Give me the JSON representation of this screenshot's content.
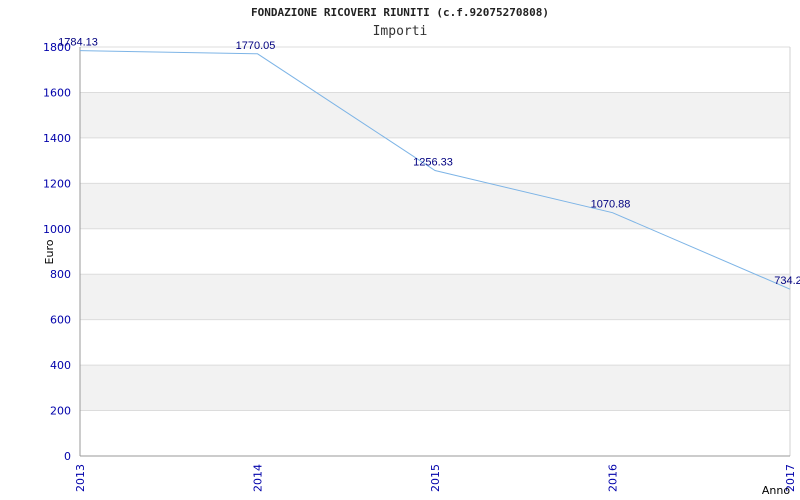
{
  "header": {
    "title": "FONDAZIONE RICOVERI RIUNITI (c.f.92075270808)",
    "subtitle": "Importi"
  },
  "chart_data": {
    "type": "line",
    "title": "FONDAZIONE RICOVERI RIUNITI (c.f.92075270808)",
    "subtitle": "Importi",
    "xlabel": "Anno",
    "ylabel": "Euro",
    "categories": [
      "2013",
      "2014",
      "2015",
      "2016",
      "2017"
    ],
    "series": [
      {
        "values": [
          1784.13,
          1770.05,
          1256.33,
          1070.88,
          734.2
        ]
      }
    ],
    "data_labels": [
      "1784.13",
      "1770.05",
      "1256.33",
      "1070.88",
      "734.2"
    ],
    "y_ticks": [
      0,
      200,
      400,
      600,
      800,
      1000,
      1200,
      1400,
      1600,
      1800
    ],
    "ylim": [
      0,
      1800
    ],
    "grid": true,
    "legend": "none",
    "colors": {
      "line": "#7db4e6",
      "band_alt": "#f2f2f2",
      "grid": "#dcdcdc",
      "axis": "#999999",
      "tick_label": "#0000aa",
      "data_label": "#000080"
    }
  }
}
